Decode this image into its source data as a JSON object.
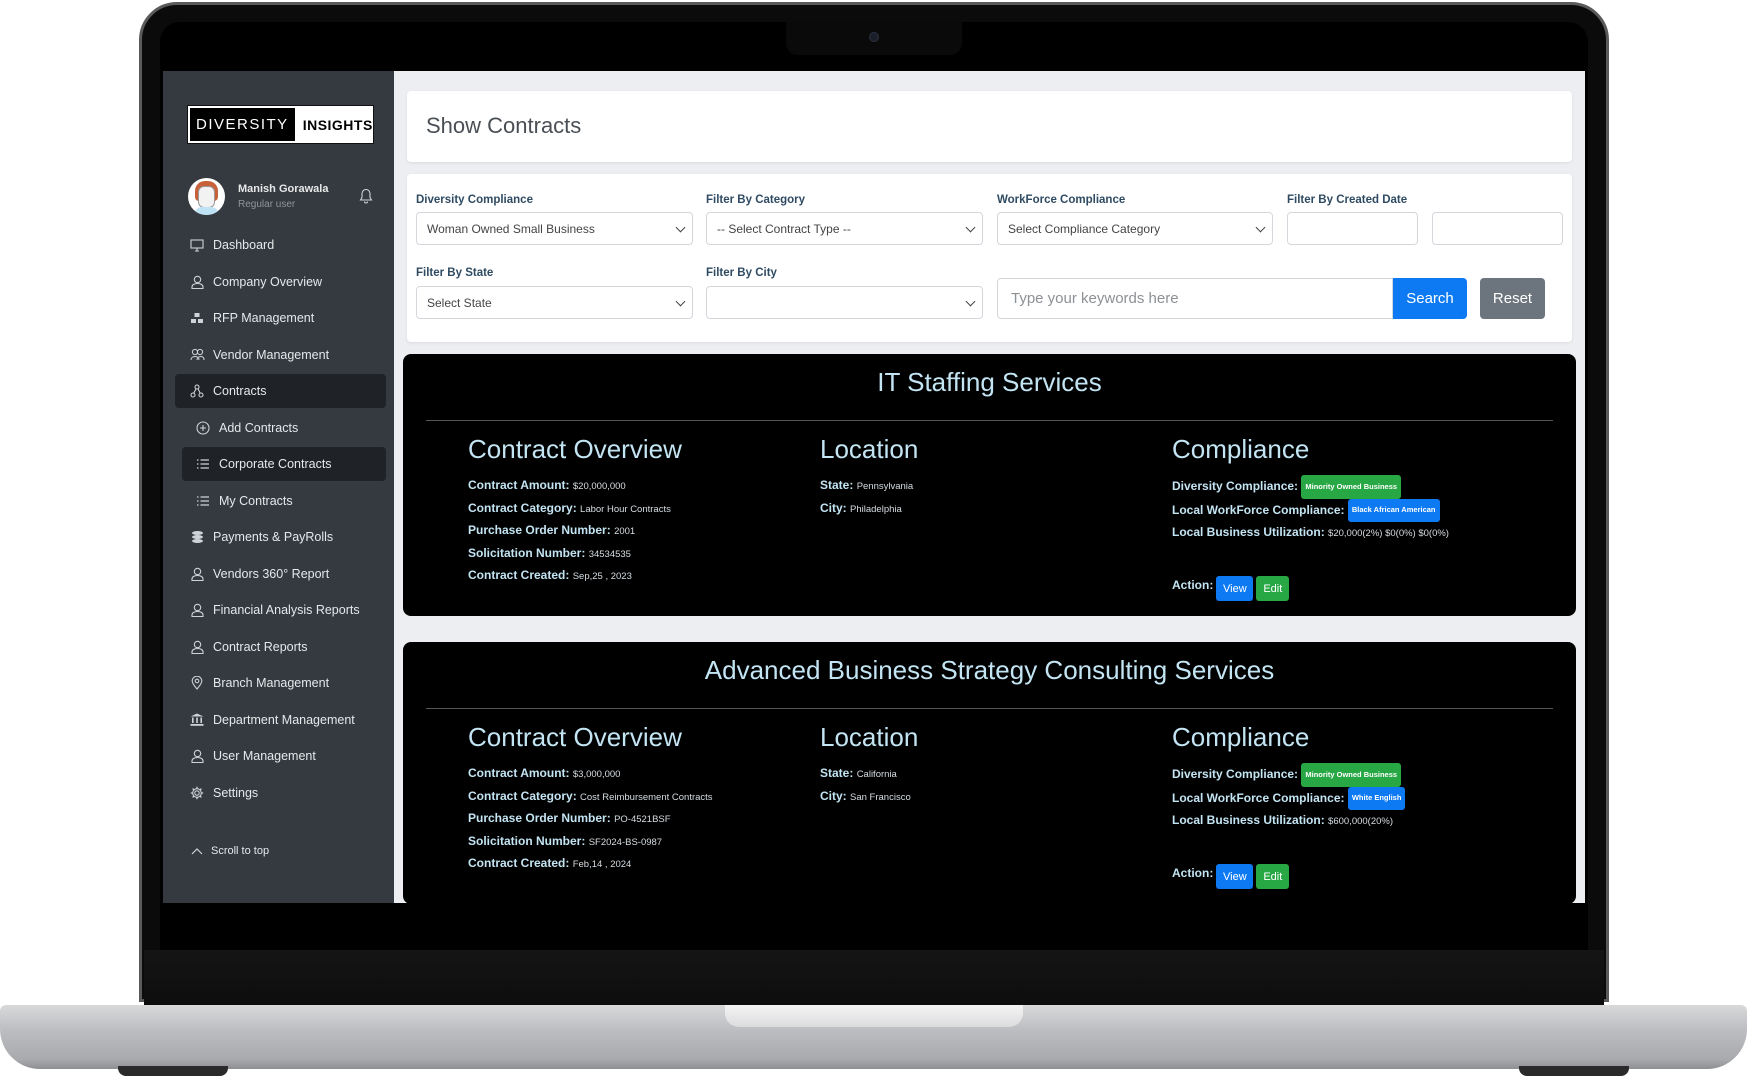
{
  "brand": {
    "part1": "DIVERSITY",
    "part2": "INSIGHTS"
  },
  "user": {
    "name": "Manish Gorawala",
    "role": "Regular user"
  },
  "sidebar": {
    "items": [
      {
        "label": "Dashboard",
        "icon": "monitor-icon"
      },
      {
        "label": "Company Overview",
        "icon": "user-icon"
      },
      {
        "label": "RFP Management",
        "icon": "boxes-icon"
      },
      {
        "label": "Vendor Management",
        "icon": "users-icon"
      },
      {
        "label": "Contracts",
        "icon": "diagram-icon",
        "active": true
      },
      {
        "label": "Add Contracts",
        "icon": "plus-circle-icon",
        "sub": true
      },
      {
        "label": "Corporate Contracts",
        "icon": "list-icon",
        "sub": true,
        "active": true
      },
      {
        "label": "My Contracts",
        "icon": "list-icon",
        "sub": true
      },
      {
        "label": "Payments & PayRolls",
        "icon": "coins-icon"
      },
      {
        "label": "Vendors 360° Report",
        "icon": "user-icon"
      },
      {
        "label": "Financial Analysis Reports",
        "icon": "user-icon"
      },
      {
        "label": "Contract Reports",
        "icon": "user-icon"
      },
      {
        "label": "Branch Management",
        "icon": "map-pin-icon"
      },
      {
        "label": "Department Management",
        "icon": "bank-icon"
      },
      {
        "label": "User Management",
        "icon": "user-icon"
      },
      {
        "label": "Settings",
        "icon": "gear-icon"
      }
    ],
    "scroll_to_top": "Scroll to top"
  },
  "page": {
    "title": "Show Contracts"
  },
  "filters": {
    "diversity_label": "Diversity Compliance",
    "diversity_value": "Woman Owned Small Business",
    "category_label": "Filter By Category",
    "category_value": "-- Select Contract Type --",
    "workforce_label": "WorkForce Compliance",
    "workforce_value": "Select Compliance Category",
    "date_label": "Filter By Created Date",
    "date_from": "",
    "date_to": "",
    "state_label": "Filter By State",
    "state_value": "Select State",
    "city_label": "Filter By City",
    "city_value": "",
    "search_placeholder": "Type your keywords here",
    "search_button": "Search",
    "reset_button": "Reset"
  },
  "labels": {
    "overview": "Contract Overview",
    "location": "Location",
    "compliance": "Compliance",
    "amount": "Contract Amount",
    "category": "Contract Category",
    "po": "Purchase Order Number",
    "solicitation": "Solicitation Number",
    "created": "Contract Created",
    "state": "State",
    "city": "City",
    "diversity": "Diversity Compliance",
    "workforce": "Local WorkForce Compliance",
    "utilization": "Local Business Utilization",
    "action": "Action:",
    "view": "View",
    "edit": "Edit"
  },
  "contracts": [
    {
      "title": "IT Staffing Services",
      "amount": "$20,000,000",
      "category": "Labor Hour Contracts",
      "po": "2001",
      "solicitation": "34534535",
      "created": "Sep,25 , 2023",
      "state": "Pennsylvania",
      "city": "Philadelphia",
      "diversity": "Minority Owned Business",
      "workforce": "Black African American",
      "utilization": "$20,000(2%) $0(0%) $0(0%)"
    },
    {
      "title": "Advanced Business Strategy Consulting Services",
      "amount": "$3,000,000",
      "category": "Cost Reimbursement Contracts",
      "po": "PO-4521BSF",
      "solicitation": "SF2024-BS-0987",
      "created": "Feb,14 , 2024",
      "state": "California",
      "city": "San Francisco",
      "diversity": "Minority Owned Business",
      "workforce": "White English",
      "utilization": "$600,000(20%)"
    }
  ],
  "colors": {
    "sidebar_bg": "#343a40",
    "primary": "#0d7af3",
    "success": "#28a745",
    "secondary": "#6c757d",
    "card_text": "#c3e4f3"
  }
}
